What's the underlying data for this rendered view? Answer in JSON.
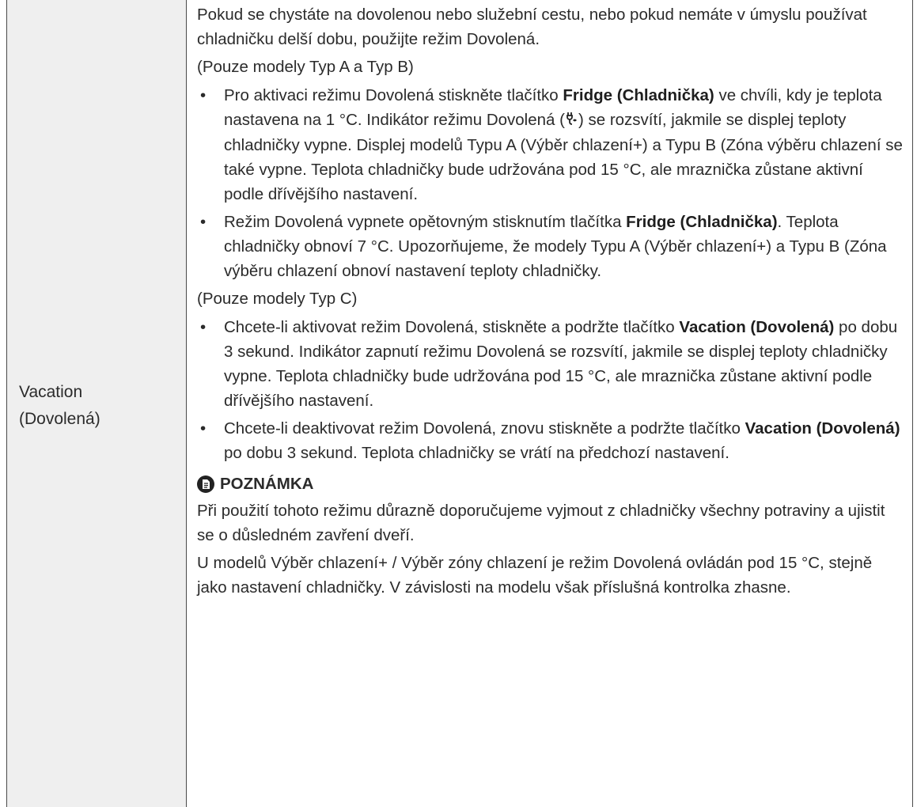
{
  "label": {
    "line1": "Vacation",
    "line2": "(Dovolená)"
  },
  "intro": "Pokud se chystáte na dovolenou nebo služební cestu, nebo pokud nemáte v úmyslu používat chladničku delší dobu, použijte režim Dovolená.",
  "sections": [
    {
      "heading": "(Pouze modely Typ A a Typ B)",
      "bullets": [
        {
          "pre": "Pro aktivaci režimu Dovolená stiskněte tlačítko ",
          "bold": "Fridge (Chladnička)",
          "mid": " ve chvíli, kdy je teplota nastavena na 1 °C. Indikátor režimu Dovolená (",
          "post": ") se rozsvítí, jakmile se displej teploty chladničky vypne. Displej modelů Typu A (Výběr chlazení+) a Typu B (Zóna výběru chlazení se také vypne. Teplota chladničky bude udržována pod 15 °C, ale mraznička zůstane aktivní podle dřívějšího nastavení."
        },
        {
          "pre": "Režim Dovolená vypnete opětovným stisknutím tlačítka ",
          "bold": "Fridge (Chladnička)",
          "post": ". Teplota chladničky obnoví 7 °C. Upozorňujeme, že modely Typu A (Výběr chlazení+) a Typu B (Zóna výběru chlazení obnoví nastavení teploty chladničky."
        }
      ]
    },
    {
      "heading": "(Pouze modely Typ C)",
      "bullets": [
        {
          "pre": "Chcete-li aktivovat režim Dovolená, stiskněte a podržte tlačítko ",
          "bold": "Vacation (Dovolená)",
          "post": " po dobu 3 sekund. Indikátor zapnutí režimu Dovolená se rozsvítí, jakmile se displej teploty chladničky vypne. Teplota chladničky bude udržována pod 15 °C, ale mraznička zůstane aktivní podle dřívějšího nastavení."
        },
        {
          "pre": "Chcete-li deaktivovat režim Dovolená, znovu stiskněte a podržte tlačítko ",
          "bold": "Vacation (Dovolená)",
          "post": " po dobu 3 sekund. Teplota chladničky se vrátí na předchozí nastavení."
        }
      ]
    }
  ],
  "note": {
    "title": "POZNÁMKA",
    "paragraphs": [
      "Při použití tohoto režimu důrazně doporučujeme vyjmout z chladničky všechny potraviny a ujistit se o důsledném zavření dveří.",
      "U modelů Výběr chlazení+ / Výběr zóny chlazení je režim Dovolená ovládán pod 15 °C, stejně jako nastavení chladničky. V závislosti na modelu však příslušná kontrolka zhasne."
    ]
  },
  "icons": {
    "vacation_indicator": "vacation-mode-icon",
    "note": "note-icon"
  }
}
